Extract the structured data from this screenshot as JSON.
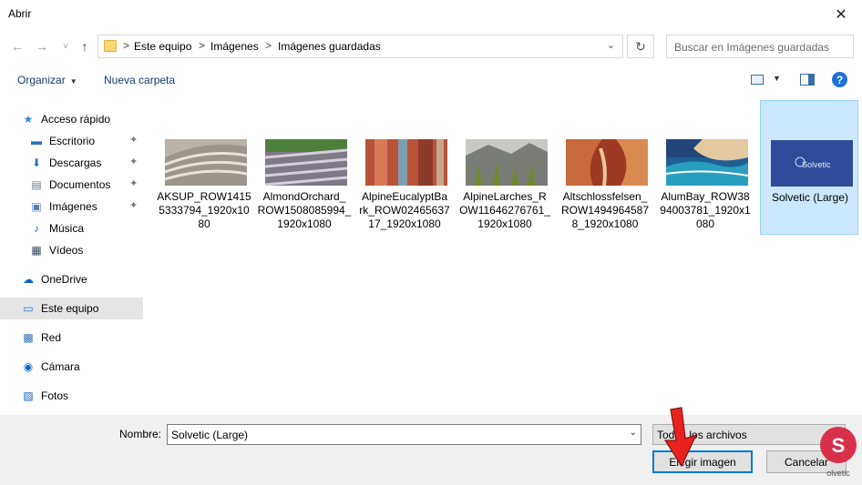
{
  "window": {
    "title": "Abrir",
    "close_glyph": "✕"
  },
  "nav": {
    "back_glyph": "←",
    "forward_glyph": "→",
    "recent_glyph": "˅",
    "up_glyph": "↑",
    "breadcrumb": [
      "Este equipo",
      "Imágenes",
      "Imágenes guardadas"
    ],
    "separator": ">",
    "refresh_glyph": "↻",
    "search_placeholder": "Buscar en Imágenes guardadas"
  },
  "toolbar": {
    "organize": "Organizar",
    "new_folder": "Nueva carpeta",
    "help": "?"
  },
  "sidebar": {
    "items": [
      {
        "label": "Acceso rápido",
        "icon": "star-icon",
        "glyph": "★",
        "color": "#3b82d6"
      },
      {
        "label": "Escritorio",
        "icon": "desktop-icon",
        "glyph": "▬",
        "color": "#2f6fc4",
        "pinned": true
      },
      {
        "label": "Descargas",
        "icon": "download-icon",
        "glyph": "⬇",
        "color": "#2f6fc4",
        "pinned": true
      },
      {
        "label": "Documentos",
        "icon": "document-icon",
        "glyph": "▤",
        "color": "#6b7b8c",
        "pinned": true
      },
      {
        "label": "Imágenes",
        "icon": "pictures-icon",
        "glyph": "▣",
        "color": "#4f7fb5",
        "pinned": true
      },
      {
        "label": "Música",
        "icon": "music-icon",
        "glyph": "♪",
        "color": "#2f6fc4"
      },
      {
        "label": "Vídeos",
        "icon": "video-icon",
        "glyph": "▦",
        "color": "#374a5e"
      },
      {
        "label": "OneDrive",
        "icon": "onedrive-icon",
        "glyph": "☁",
        "color": "#0a64c8"
      },
      {
        "label": "Este equipo",
        "icon": "this-pc-icon",
        "glyph": "▭",
        "color": "#2f6fc4"
      },
      {
        "label": "Red",
        "icon": "network-icon",
        "glyph": "▩",
        "color": "#2f6fc4"
      },
      {
        "label": "Cámara",
        "icon": "camera-icon",
        "glyph": "◉",
        "color": "#0a64c8"
      },
      {
        "label": "Fotos",
        "icon": "photos-icon",
        "glyph": "▨",
        "color": "#0a64c8"
      }
    ],
    "pin_glyph": "📌",
    "selected": "Este equipo"
  },
  "files": [
    {
      "name": "AKSUP_ROW14155333794_1920x1080",
      "lines": [
        "AKSUP_ROW1415",
        "5333794_1920x10",
        "80"
      ],
      "thumb": "thumb-aksup"
    },
    {
      "name": "AlmondOrchard_ROW15080859941920x1080",
      "lines": [
        "AlmondOrchard_",
        "ROW1508085994_",
        "1920x1080"
      ],
      "thumb": "thumb-almond"
    },
    {
      "name": "AlpineEucalyptBark",
      "lines": [
        "AlpineEucalyptBa",
        "rk_ROW02465637",
        "17_1920x1080"
      ],
      "thumb": "thumb-eucalypt"
    },
    {
      "name": "AlpineLarches",
      "lines": [
        "AlpineLarches_R",
        "OW11646276761_",
        "1920x1080"
      ],
      "thumb": "thumb-larches"
    },
    {
      "name": "Altschlossfelsen",
      "lines": [
        "Altschlossfelsen_",
        "ROW1494964587",
        "8_1920x1080"
      ],
      "thumb": "thumb-altschloss"
    },
    {
      "name": "AlumBay",
      "lines": [
        "AlumBay_ROW38",
        "94003781_1920x1",
        "080"
      ],
      "thumb": "thumb-alumbay"
    },
    {
      "name": "Solvetic (Large)",
      "lines": [
        "Solvetic (Large)"
      ],
      "thumb": "thumb-solvetic",
      "selected": true
    }
  ],
  "solvetic_thumb_text": "Solvetic",
  "bottom": {
    "name_label": "Nombre:",
    "name_value": "Solvetic (Large)",
    "filter_value": "Todos los archivos",
    "open_button": "Elegir imagen",
    "cancel_button": "Cancelar"
  }
}
